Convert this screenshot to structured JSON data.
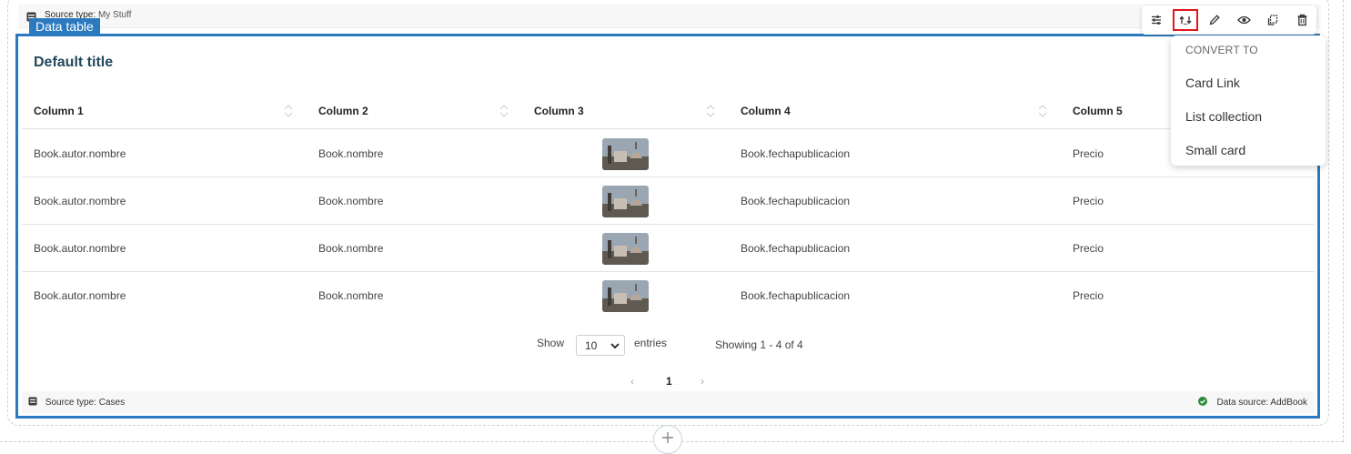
{
  "source_header": {
    "label": "Source type:",
    "value": "My Stuff"
  },
  "block_tag": "Data table",
  "table": {
    "title": "Default title",
    "columns": [
      "Column 1",
      "Column 2",
      "Column 3",
      "Column 4",
      "Column 5"
    ],
    "rows": [
      [
        "Book.autor.nombre",
        "Book.nombre",
        "image",
        "Book.fechapublicacion",
        "Precio"
      ],
      [
        "Book.autor.nombre",
        "Book.nombre",
        "image",
        "Book.fechapublicacion",
        "Precio"
      ],
      [
        "Book.autor.nombre",
        "Book.nombre",
        "image",
        "Book.fechapublicacion",
        "Precio"
      ],
      [
        "Book.autor.nombre",
        "Book.nombre",
        "image",
        "Book.fechapublicacion",
        "Precio"
      ]
    ],
    "show_label": "Show",
    "entries_value": "10",
    "entries_label": "entries",
    "showing_text": "Showing 1 - 4 of 4",
    "pagination": {
      "prev": "‹",
      "current": "1",
      "next": "›"
    }
  },
  "footer": {
    "source_label": "Source type:",
    "source_value": "Cases",
    "data_source_label": "Data source:",
    "data_source_value": "AddBook"
  },
  "toolbar": {
    "buttons": [
      "settings-sliders-icon",
      "convert-icon",
      "edit-pencil-icon",
      "preview-eye-icon",
      "duplicate-icon",
      "delete-trash-icon"
    ],
    "active": "convert-icon"
  },
  "convert_menu": {
    "heading": "CONVERT TO",
    "items": [
      "Card Link",
      "List collection",
      "Small card"
    ]
  },
  "colors": {
    "accent": "#2b7ac0",
    "title": "#23485a",
    "active_outline": "#e01919",
    "status_ok": "#2e8b3c"
  }
}
